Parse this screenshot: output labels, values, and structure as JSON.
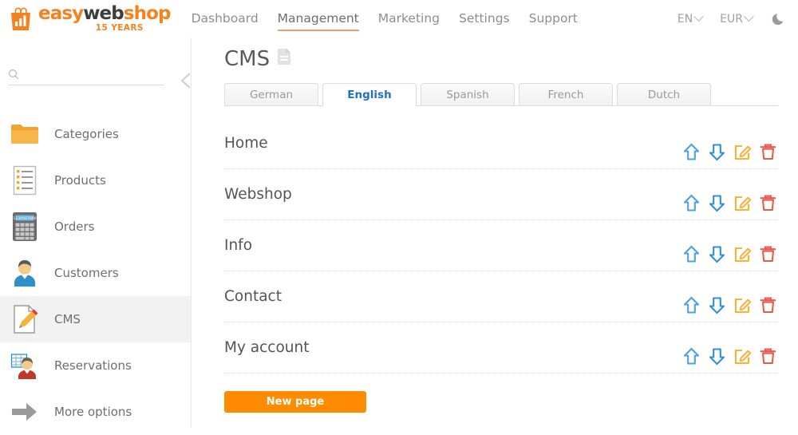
{
  "header": {
    "logo": {
      "icon": "shopping-bag-chart-icon",
      "easy": "easy",
      "web": "web",
      "shop": "shop",
      "years": "15 YEARS"
    },
    "nav": [
      {
        "label": "Dashboard",
        "active": false
      },
      {
        "label": "Management",
        "active": true
      },
      {
        "label": "Marketing",
        "active": false
      },
      {
        "label": "Settings",
        "active": false
      },
      {
        "label": "Support",
        "active": false
      }
    ],
    "language": "EN",
    "currency": "EUR",
    "theme_toggle_icon": "moon-icon"
  },
  "sidebar": {
    "search": {
      "placeholder": "",
      "value": "",
      "icon": "search-icon"
    },
    "collapse_icon": "chevron-left-icon",
    "items": [
      {
        "label": "Categories",
        "icon": "folder-icon",
        "active": false
      },
      {
        "label": "Products",
        "icon": "list-page-icon",
        "active": false
      },
      {
        "label": "Orders",
        "icon": "calculator-icon",
        "active": false
      },
      {
        "label": "Customers",
        "icon": "user-icon",
        "active": false
      },
      {
        "label": "CMS",
        "icon": "page-pencil-icon",
        "active": true
      },
      {
        "label": "Reservations",
        "icon": "table-user-icon",
        "active": false
      },
      {
        "label": "More options",
        "icon": "arrow-right-icon",
        "active": false
      }
    ]
  },
  "main": {
    "title": "CMS",
    "title_icon": "document-icon",
    "tabs": [
      {
        "label": "German",
        "active": false
      },
      {
        "label": "English",
        "active": true
      },
      {
        "label": "Spanish",
        "active": false
      },
      {
        "label": "French",
        "active": false
      },
      {
        "label": "Dutch",
        "active": false
      }
    ],
    "pages": [
      {
        "name": "Home"
      },
      {
        "name": "Webshop"
      },
      {
        "name": "Info"
      },
      {
        "name": "Contact"
      },
      {
        "name": "My account"
      }
    ],
    "row_actions": [
      {
        "name": "move-up-icon",
        "title": "Move up"
      },
      {
        "name": "move-down-icon",
        "title": "Move down"
      },
      {
        "name": "edit-icon",
        "title": "Edit"
      },
      {
        "name": "delete-icon",
        "title": "Delete"
      }
    ],
    "new_page_button": "New page"
  },
  "colors": {
    "brand_orange": "#f5821f",
    "button_orange": "#ff8c00",
    "active_tab_blue": "#1f6fd0",
    "arrow_blue": "#4aa3e0",
    "edit_orange": "#f5b33c",
    "delete_red": "#ea5a4f"
  }
}
